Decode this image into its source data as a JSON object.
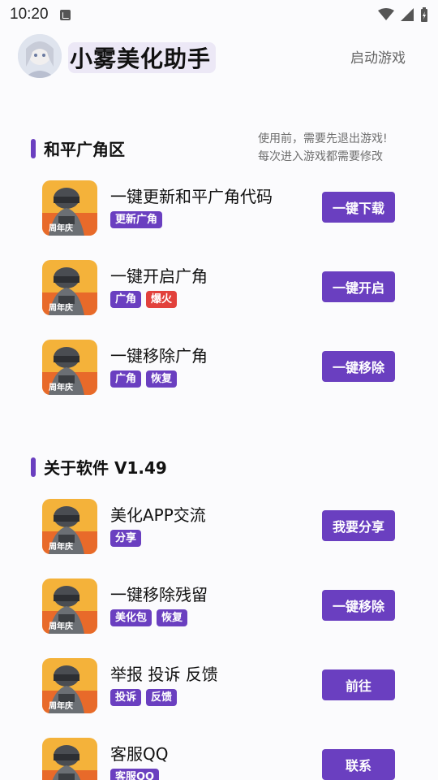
{
  "status": {
    "time": "10:20"
  },
  "header": {
    "title": "小雾美化助手",
    "launch_label": "启动游戏"
  },
  "section1": {
    "title": "和平广角区",
    "notice_line1": "使用前，需要先退出游戏!",
    "notice_line2": "每次进入游戏都需要修改",
    "items": [
      {
        "title": "一键更新和平广角代码",
        "tags": [
          "更新广角"
        ],
        "button": "一键下载"
      },
      {
        "title": "一键开启广角",
        "tags": [
          "广角",
          "爆火"
        ],
        "button": "一键开启"
      },
      {
        "title": "一键移除广角",
        "tags": [
          "广角",
          "恢复"
        ],
        "button": "一键移除"
      }
    ]
  },
  "section2": {
    "title": "关于软件 V1.49",
    "items": [
      {
        "title": "美化APP交流",
        "tags": [
          "分享"
        ],
        "button": "我要分享"
      },
      {
        "title": "一键移除残留",
        "tags": [
          "美化包",
          "恢复"
        ],
        "button": "一键移除"
      },
      {
        "title": "举报 投诉 反馈",
        "tags": [
          "投诉",
          "反馈"
        ],
        "button": "前往"
      },
      {
        "title": "客服QQ",
        "tags": [
          "客服QQ"
        ],
        "button": "联系"
      }
    ]
  },
  "colors": {
    "accent": "#6a3fc0",
    "hot": "#e2413c"
  }
}
